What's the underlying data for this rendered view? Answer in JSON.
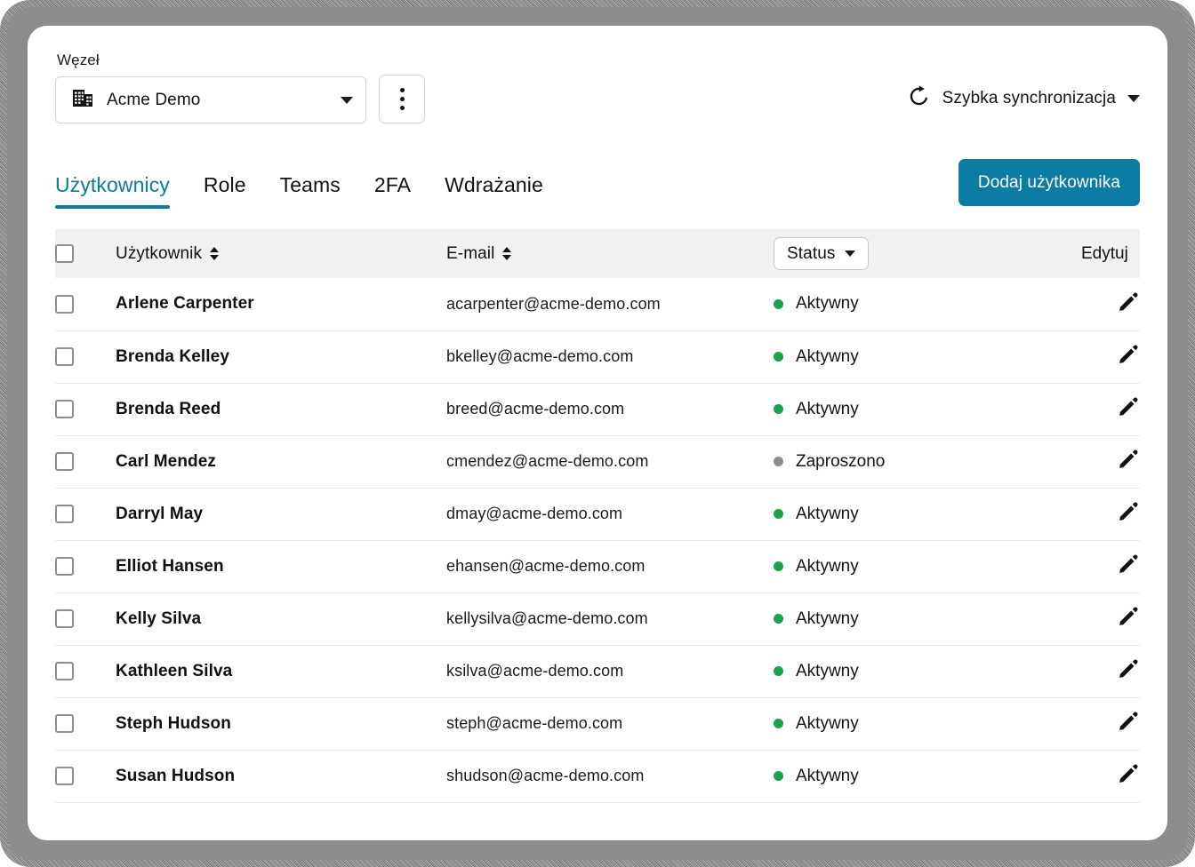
{
  "theme": {
    "accent": "#0c7ba4",
    "button_bg": "#0d7ca5",
    "status_active_dot": "#1aa34a",
    "status_invited_dot": "#8d8d8d",
    "table_header_bg": "#f1f1f1",
    "frame_gray": "#8c8c8c"
  },
  "node": {
    "label": "Węzeł",
    "selected": "Acme Demo",
    "building_icon": "building-icon",
    "caret_icon": "chevron-down-icon",
    "kebab_icon": "kebab-menu-icon"
  },
  "sync": {
    "icon": "refresh-icon",
    "label": "Szybka synchronizacja",
    "caret_icon": "chevron-down-icon"
  },
  "tabs": [
    {
      "label": "Użytkownicy",
      "active": true
    },
    {
      "label": "Role",
      "active": false
    },
    {
      "label": "Teams",
      "active": false
    },
    {
      "label": "2FA",
      "active": false
    },
    {
      "label": "Wdrażanie",
      "active": false
    }
  ],
  "actions": {
    "add_user": "Dodaj użytkownika"
  },
  "table": {
    "headers": {
      "user": "Użytkownik",
      "email": "E-mail",
      "status": "Status",
      "edit": "Edytuj"
    },
    "rows": [
      {
        "name": "Arlene Carpenter",
        "email": "acarpenter@acme-demo.com",
        "status": "Aktywny",
        "status_key": "active"
      },
      {
        "name": "Brenda Kelley",
        "email": "bkelley@acme-demo.com",
        "status": "Aktywny",
        "status_key": "active"
      },
      {
        "name": "Brenda Reed",
        "email": "breed@acme-demo.com",
        "status": "Aktywny",
        "status_key": "active"
      },
      {
        "name": "Carl Mendez",
        "email": "cmendez@acme-demo.com",
        "status": "Zaproszono",
        "status_key": "invited"
      },
      {
        "name": "Darryl May",
        "email": "dmay@acme-demo.com",
        "status": "Aktywny",
        "status_key": "active"
      },
      {
        "name": "Elliot Hansen",
        "email": "ehansen@acme-demo.com",
        "status": "Aktywny",
        "status_key": "active"
      },
      {
        "name": "Kelly Silva",
        "email": "kellysilva@acme-demo.com",
        "status": "Aktywny",
        "status_key": "active"
      },
      {
        "name": "Kathleen Silva",
        "email": "ksilva@acme-demo.com",
        "status": "Aktywny",
        "status_key": "active"
      },
      {
        "name": "Steph Hudson",
        "email": "steph@acme-demo.com",
        "status": "Aktywny",
        "status_key": "active"
      },
      {
        "name": "Susan Hudson",
        "email": "shudson@acme-demo.com",
        "status": "Aktywny",
        "status_key": "active"
      }
    ]
  }
}
